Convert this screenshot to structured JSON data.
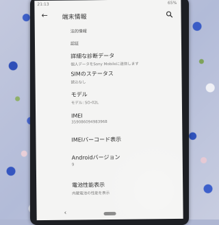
{
  "status": {
    "time": "21:13",
    "battery": "65%"
  },
  "appbar": {
    "title": "端末情報"
  },
  "rows": [
    {
      "title": "法的情報",
      "subtitle": ""
    },
    {
      "title": "認証",
      "subtitle": ""
    },
    {
      "title": "詳細な診断データ",
      "subtitle": "個人データをSony Mobileに送信します"
    },
    {
      "title": "SIMのステータス",
      "subtitle": "読込なし"
    },
    {
      "title": "モデル",
      "subtitle": "モデル: SO-02L"
    },
    {
      "title": "IMEI",
      "subtitle": "359086094983968"
    },
    {
      "title": "IMEIバーコード表示",
      "subtitle": ""
    },
    {
      "title": "Androidバージョン",
      "subtitle": "9"
    },
    {
      "title": "電池性能表示",
      "subtitle": "内蔵電池の性能を表示"
    }
  ],
  "colors": {
    "screen_bg": "#f4f4f3",
    "text": "#2e2e2e",
    "subtext": "#7a7a7a",
    "bezel": "#1d1f24"
  },
  "icons": {
    "back": "back-arrow-icon",
    "search": "search-icon",
    "nav_back": "nav-back-icon",
    "nav_home": "home-pill-icon"
  }
}
